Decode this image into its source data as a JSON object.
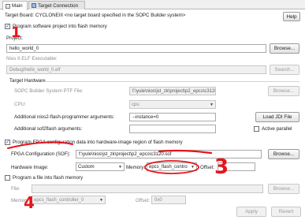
{
  "tabs": [
    {
      "label": "Main",
      "active": true
    },
    {
      "label": "Target Connection",
      "active": false
    }
  ],
  "target_board": "Target Board: CYCLONEIII <no target board specified in the SOPC Builder system>",
  "help_label": "Help",
  "software": {
    "checkbox_label": "Program software project into flash memory",
    "checked": true,
    "project_label": "Project:",
    "project_value": "hello_world_0",
    "browse_label": "Browse...",
    "elf_label": "Nios II ELF Executable:",
    "elf_value": "Debug/hello_world_0.elf",
    "search_label": "Search..."
  },
  "target_hardware": {
    "title": "Target Hardware",
    "ptf_label": "SOPC Builder System PTF File:",
    "ptf_value": "f:\\yule\\nios\\jst_zk\\project\\p2_epcs\\c3120_sopc.ptf",
    "cpu_label": "CPU:",
    "cpu_value": "cpu",
    "args_label": "Additional nios2-flash-programmer arguments:",
    "args_value": "--instance=0",
    "load_jdi_label": "Load JDI File",
    "sof2_label": "Additional sof2flash arguments:",
    "active_parallel_label": "Active parallel"
  },
  "fpga": {
    "checkbox_label": "Program FPGA configuration data into hardware-image region of flash memory",
    "checked": true,
    "sof_label": "FPGA Configuration (SOF):",
    "sof_value": "f:\\yule\\nios\\jst_zk\\project\\p2_epcs\\c3120.sof",
    "browse_label": "Browse...",
    "hardware_image_label": "Hardware Image:",
    "hardware_image_value": "Custom",
    "memory_label": "Memory:",
    "memory_value": "epcs_flash_contro",
    "offset_label": "Offset:",
    "offset_value": ""
  },
  "file": {
    "checkbox_label": "Program a file into flash memory",
    "checked": false,
    "file_label": "File:",
    "memory_label": "Memory:",
    "memory_value": "epcs_flash_controller_0",
    "offset_label": "Offset:",
    "offset_value": "0x0"
  },
  "footer": {
    "apply_label": "Apply",
    "revert_label": "Revert"
  },
  "annotations": {
    "mark_1": "1",
    "mark_3": "3",
    "mark_4": "4",
    "color": "#e8141c"
  }
}
